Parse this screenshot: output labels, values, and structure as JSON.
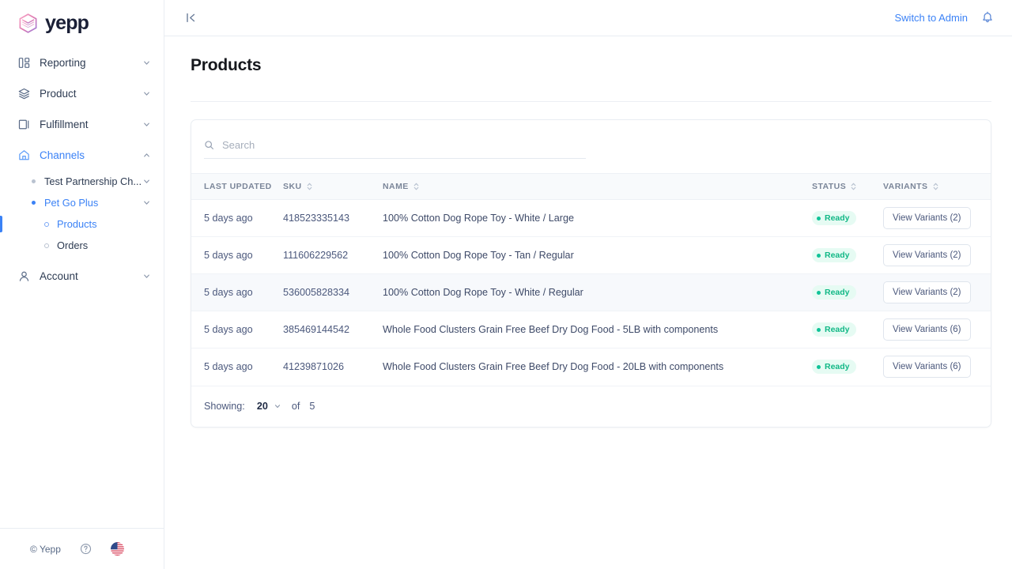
{
  "brand": {
    "name": "yepp",
    "logo_icon": "hex-cube-logo"
  },
  "sidebar": {
    "nav": [
      {
        "label": "Reporting",
        "icon": "dashboard-icon",
        "chevron": "chevron-down-icon"
      },
      {
        "label": "Product",
        "icon": "layers-icon",
        "chevron": "chevron-down-icon"
      },
      {
        "label": "Fulfillment",
        "icon": "package-icon",
        "chevron": "chevron-down-icon"
      },
      {
        "label": "Channels",
        "icon": "home-icon",
        "chevron": "chevron-up-icon"
      }
    ],
    "channels_children": [
      {
        "label": "Test Partnership Ch...",
        "chevron": "chevron-down-icon"
      },
      {
        "label": "Pet Go Plus",
        "chevron": "chevron-down-icon"
      }
    ],
    "petgo_children": [
      {
        "label": "Products"
      },
      {
        "label": "Orders"
      }
    ],
    "account": {
      "label": "Account",
      "icon": "user-icon",
      "chevron": "chevron-down-icon"
    },
    "footer": {
      "copyright": "© Yepp",
      "help_icon": "help-circle-icon",
      "flag_icon": "us-flag-icon"
    }
  },
  "topbar": {
    "collapse_icon": "collapse-sidebar-icon",
    "switch_admin_label": "Switch to Admin",
    "bell_icon": "notification-bell-icon",
    "accent_color": "#3b82f6"
  },
  "page": {
    "title": "Products"
  },
  "search": {
    "placeholder": "Search",
    "value": "",
    "icon": "search-icon"
  },
  "table": {
    "columns": [
      {
        "label": "Last Updated",
        "sortable": false
      },
      {
        "label": "SKU",
        "sortable": true
      },
      {
        "label": "Name",
        "sortable": true
      },
      {
        "label": "Status",
        "sortable": true
      },
      {
        "label": "Variants",
        "sortable": true
      }
    ],
    "rows": [
      {
        "last_updated": "5 days ago",
        "sku": "418523335143",
        "name": "100% Cotton Dog Rope Toy - White / Large",
        "status": "Ready",
        "variants_label": "View Variants (2)",
        "highlighted": false
      },
      {
        "last_updated": "5 days ago",
        "sku": "111606229562",
        "name": "100% Cotton Dog Rope Toy - Tan / Regular",
        "status": "Ready",
        "variants_label": "View Variants (2)",
        "highlighted": false
      },
      {
        "last_updated": "5 days ago",
        "sku": "536005828334",
        "name": "100% Cotton Dog Rope Toy - White / Regular",
        "status": "Ready",
        "variants_label": "View Variants (2)",
        "highlighted": true
      },
      {
        "last_updated": "5 days ago",
        "sku": "385469144542",
        "name": "Whole Food Clusters Grain Free Beef Dry Dog Food - 5LB with components",
        "status": "Ready",
        "variants_label": "View Variants (6)",
        "highlighted": false
      },
      {
        "last_updated": "5 days ago",
        "sku": "41239871026",
        "name": "Whole Food Clusters Grain Free Beef Dry Dog Food - 20LB with components",
        "status": "Ready",
        "variants_label": "View Variants (6)",
        "highlighted": false
      }
    ]
  },
  "footer": {
    "showing_label": "Showing:",
    "page_size": "20",
    "of_label": "of",
    "total": "5"
  },
  "colors": {
    "accent_blue": "#3b82f6",
    "status_green_text": "#12b886",
    "status_green_bg": "#e6fbf3",
    "row_highlight": "#f7f9fc"
  }
}
